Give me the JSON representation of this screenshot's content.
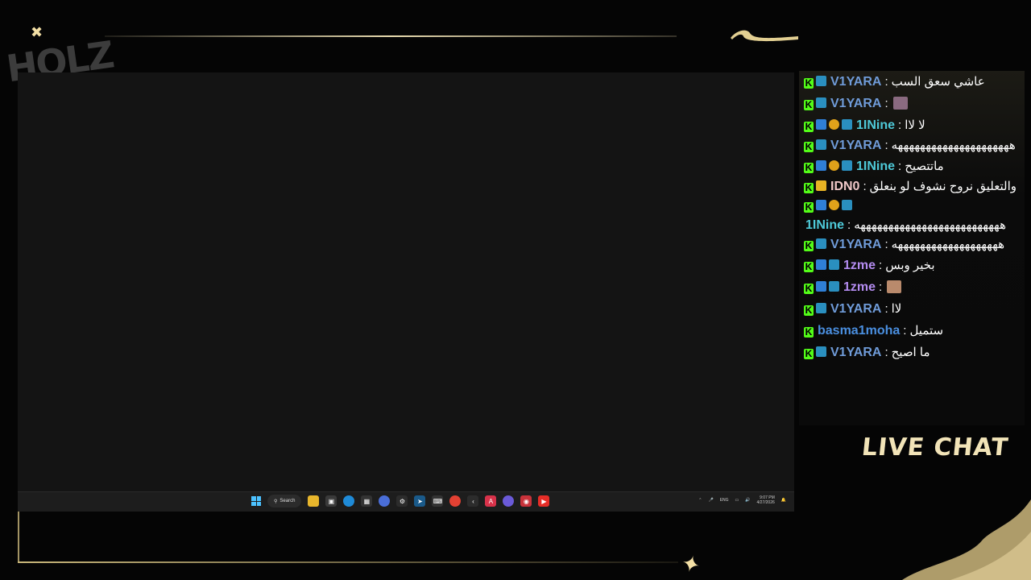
{
  "overlay": {
    "logo_text": "HOLZ",
    "live_chat_label": "LIVE CHAT"
  },
  "taskbar": {
    "search_label": "Search",
    "language": "ENG",
    "time": "9:07 PM",
    "date": "4/27/2026"
  },
  "chat": {
    "messages": [
      {
        "user": "V1YARA",
        "user_color": "#6f9bd8",
        "badges": [
          "kick",
          "og"
        ],
        "text": "عاشي سعق السب"
      },
      {
        "user": "V1YARA",
        "user_color": "#6f9bd8",
        "badges": [
          "kick",
          "og"
        ],
        "text": "",
        "emote": "e1"
      },
      {
        "user": "1INine",
        "user_color": "#4ec9d8",
        "badges": [
          "kick",
          "verified",
          "one",
          "og"
        ],
        "text": "لا لاا"
      },
      {
        "user": "V1YARA",
        "user_color": "#6f9bd8",
        "badges": [
          "kick",
          "og"
        ],
        "text": "هههههههههههههههههههههه"
      },
      {
        "user": "1INine",
        "user_color": "#4ec9d8",
        "badges": [
          "kick",
          "verified",
          "one",
          "og"
        ],
        "text": "ماتتصيح"
      },
      {
        "user": "IDN0",
        "user_color": "#f0c8c8",
        "badges": [
          "kick",
          "crown"
        ],
        "text": "والتعليق نروح نشوف لو بنعلق"
      },
      {
        "user": "1INine",
        "user_color": "#4ec9d8",
        "badges": [
          "kick",
          "verified",
          "one",
          "og"
        ],
        "text": "ههههههههههههههههههههههههههه"
      },
      {
        "user": "V1YARA",
        "user_color": "#6f9bd8",
        "badges": [
          "kick",
          "og"
        ],
        "text": "هههههههههههههههههههه"
      },
      {
        "user": "1zme",
        "user_color": "#b48cf0",
        "badges": [
          "kick",
          "verified",
          "og"
        ],
        "text": "بخير وبس"
      },
      {
        "user": "1zme",
        "user_color": "#b48cf0",
        "badges": [
          "kick",
          "verified",
          "og"
        ],
        "text": "",
        "emote": "e2"
      },
      {
        "user": "V1YARA",
        "user_color": "#6f9bd8",
        "badges": [
          "kick",
          "og"
        ],
        "text": "لاا"
      },
      {
        "user": "basma1moha",
        "user_color": "#4a8fe0",
        "badges": [
          "kick"
        ],
        "text": "ستميل"
      },
      {
        "user": "V1YARA",
        "user_color": "#6f9bd8",
        "badges": [
          "kick",
          "og"
        ],
        "text": "ما اصيح"
      }
    ]
  },
  "colors": {
    "accent_gold": "#e9dcb0",
    "kick_green": "#53fc18"
  }
}
